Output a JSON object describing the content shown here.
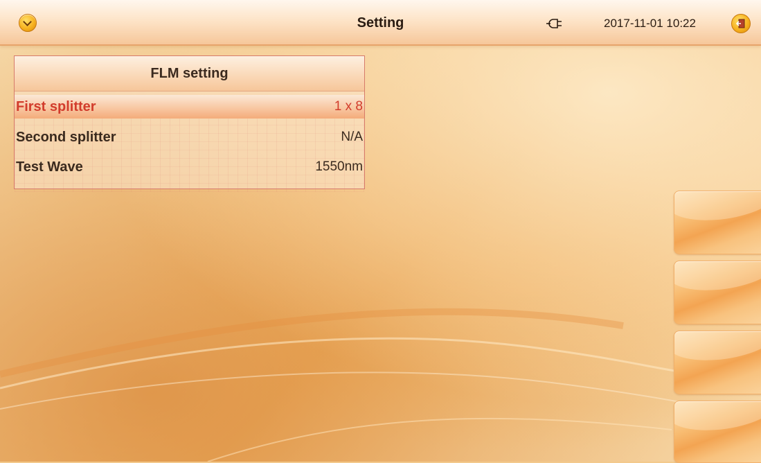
{
  "header": {
    "title": "Setting",
    "datetime": "2017-11-01 10:22"
  },
  "icons": {
    "menu": "chevron-down-circle-icon",
    "power": "plug-icon",
    "exit": "exit-door-icon"
  },
  "panel": {
    "title": "FLM setting",
    "rows": [
      {
        "label": "First splitter",
        "value": "1 x 8",
        "selected": true
      },
      {
        "label": "Second splitter",
        "value": "N/A",
        "selected": false
      },
      {
        "label": "Test Wave",
        "value": "1550nm",
        "selected": false
      }
    ]
  },
  "side_buttons": [
    {
      "label": ""
    },
    {
      "label": ""
    },
    {
      "label": ""
    },
    {
      "label": ""
    }
  ],
  "colors": {
    "selected_text": "#d23c2c",
    "accent": "#f7b21f",
    "background": "#f3c98c"
  }
}
